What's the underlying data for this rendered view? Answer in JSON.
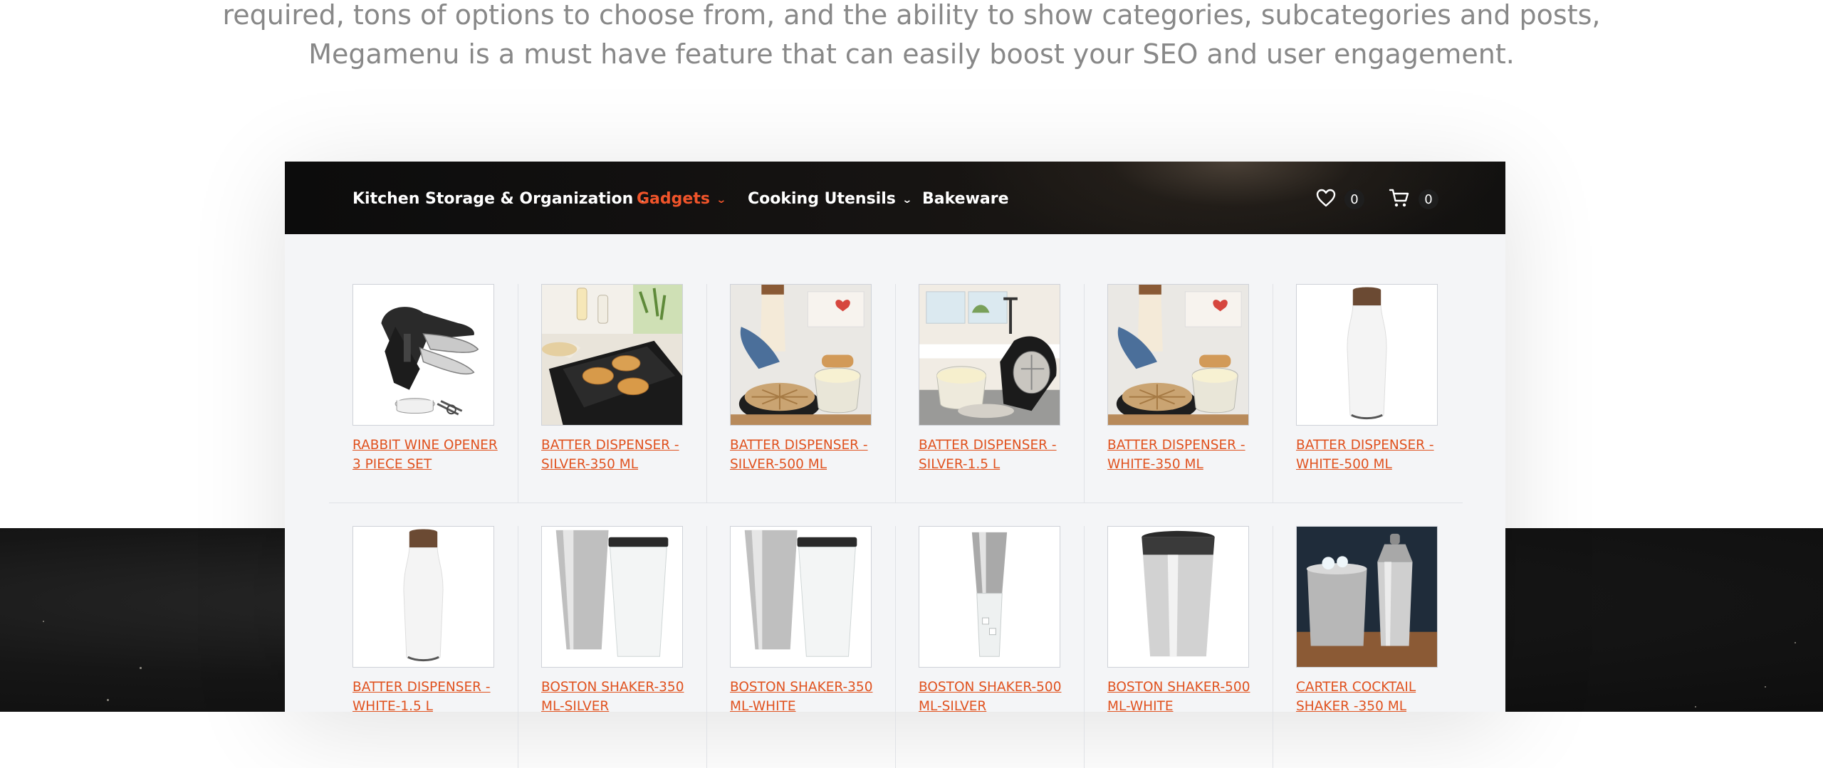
{
  "intro": {
    "line1": "required, tons of options to choose from, and the ability to show categories, subcategories and posts,",
    "line2": "Megamenu is a must have feature that can easily boost your SEO and user engagement."
  },
  "nav": {
    "items": [
      {
        "label": "Kitchen Storage & Organization",
        "has_dropdown": true,
        "active": false
      },
      {
        "label": "Gadgets",
        "has_dropdown": true,
        "active": true
      },
      {
        "label": "Cooking Utensils",
        "has_dropdown": true,
        "active": false
      },
      {
        "label": "Bakeware",
        "has_dropdown": false,
        "active": false
      }
    ],
    "wishlist_icon": "heart-icon",
    "wishlist_count": "0",
    "cart_icon": "cart-icon",
    "cart_count": "0",
    "active_color": "#f0542a"
  },
  "products": [
    {
      "label": "RABBIT WINE OPENER 3 PIECE SET",
      "image": "wine-opener"
    },
    {
      "label": "BATTER DISPENSER -SILVER-350 ML",
      "image": "pancake-griddle"
    },
    {
      "label": "BATTER DISPENSER -SILVER-500 ML",
      "image": "batter-waffle"
    },
    {
      "label": "BATTER DISPENSER -SILVER-1.5 L",
      "image": "waffle-maker-kitchen"
    },
    {
      "label": "BATTER DISPENSER -WHITE-350 ML",
      "image": "batter-waffle"
    },
    {
      "label": "BATTER DISPENSER -WHITE-500 ML",
      "image": "white-bottle"
    },
    {
      "label": "BATTER DISPENSER -WHITE-1.5 L",
      "image": "white-bottle"
    },
    {
      "label": "BOSTON SHAKER-350 ML-SILVER",
      "image": "boston-shaker"
    },
    {
      "label": "BOSTON SHAKER-350 ML-WHITE",
      "image": "boston-shaker"
    },
    {
      "label": "BOSTON SHAKER-500 ML-SILVER",
      "image": "shaker-nested"
    },
    {
      "label": "BOSTON SHAKER-500 ML-WHITE",
      "image": "steel-tumbler"
    },
    {
      "label": "CARTER COCKTAIL SHAKER -350 ML",
      "image": "cocktail-set"
    }
  ],
  "link_color": "#e0521f"
}
